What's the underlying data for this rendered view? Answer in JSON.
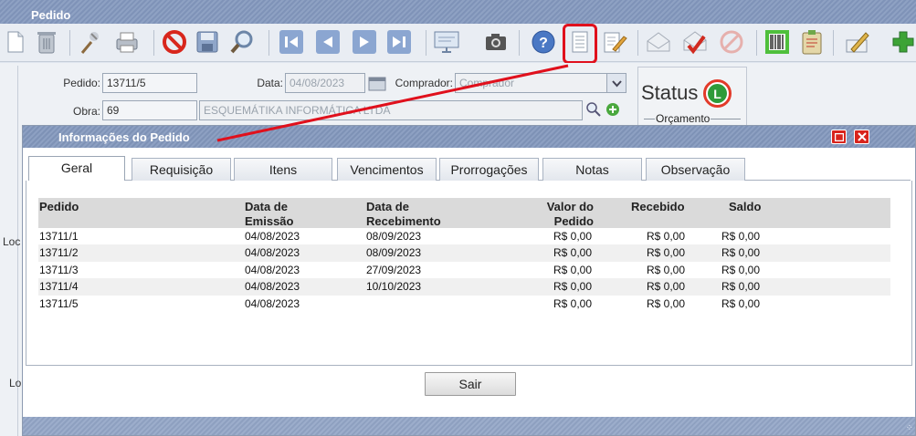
{
  "window": {
    "title": "Pedido"
  },
  "toolbar": {
    "icons": [
      "new-document-icon",
      "trash-icon",
      "wizard-icon",
      "printer-icon",
      "cancel-icon",
      "save-icon",
      "search-icon",
      "first-record-icon",
      "previous-record-icon",
      "next-record-icon",
      "last-record-icon",
      "preview-icon",
      "camera-icon",
      "help-icon",
      "document-info-icon",
      "edit-note-icon",
      "approve-envelope-icon",
      "disapprove-envelope-icon",
      "blocked-icon",
      "barcode-icon",
      "clipboard-icon",
      "sign-icon",
      "add-icon"
    ]
  },
  "form": {
    "pedido_label": "Pedido:",
    "pedido_value": "13711/5",
    "data_label": "Data:",
    "data_value": "04/08/2023",
    "comprador_label": "Comprador:",
    "comprador_value": "Comprador",
    "obra_label": "Obra:",
    "obra_value": "69",
    "obra_name": "ESQUEMÁTIKA INFORMÁTICA LTDA",
    "left_label_1": "Loc",
    "left_label_2": "Lo"
  },
  "status": {
    "label": "Status",
    "badge": "L",
    "group_label": "Orçamento"
  },
  "modal": {
    "title": "Informações do Pedido",
    "tabs": [
      "Geral",
      "Requisição",
      "Itens",
      "Vencimentos",
      "Prorrogações",
      "Notas",
      "Observação"
    ],
    "active_tab": "Geral",
    "table": {
      "headers": [
        "Pedido",
        "Data de Emissão",
        "Data de Recebimento",
        "Valor do Pedido",
        "Recebido",
        "Saldo"
      ],
      "header_lines": {
        "pedido": "Pedido",
        "emissao_1": "Data de",
        "emissao_2": "Emissão",
        "receb_1": "Data de",
        "receb_2": "Recebimento",
        "valor_1": "Valor do",
        "valor_2": "Pedido",
        "recebido": "Recebido",
        "saldo": "Saldo"
      },
      "rows": [
        [
          "13711/1",
          "04/08/2023",
          "08/09/2023",
          "R$ 0,00",
          "R$ 0,00",
          "R$ 0,00"
        ],
        [
          "13711/2",
          "04/08/2023",
          "08/09/2023",
          "R$ 0,00",
          "R$ 0,00",
          "R$ 0,00"
        ],
        [
          "13711/3",
          "04/08/2023",
          "27/09/2023",
          "R$ 0,00",
          "R$ 0,00",
          "R$ 0,00"
        ],
        [
          "13711/4",
          "04/08/2023",
          "10/10/2023",
          "R$ 0,00",
          "R$ 0,00",
          "R$ 0,00"
        ],
        [
          "13711/5",
          "04/08/2023",
          "",
          "R$ 0,00",
          "R$ 0,00",
          "R$ 0,00"
        ]
      ]
    },
    "close_button": "Sair"
  },
  "colors": {
    "titlebar": "#8497b9",
    "annotation": "#e0101c",
    "status_green": "#2e9b3a",
    "status_ring": "#e23a2a"
  }
}
